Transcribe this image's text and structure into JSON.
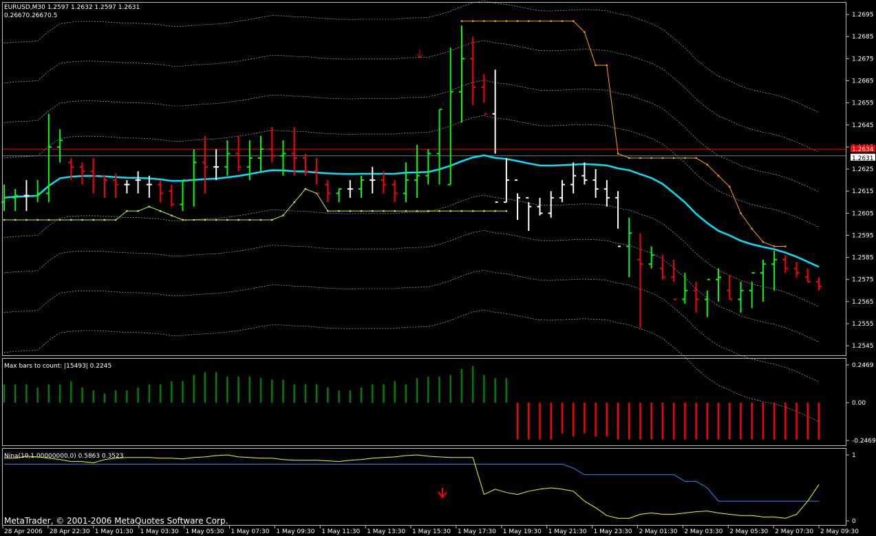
{
  "main_panel": {
    "symbol_line": "EURUSD,M30  1.2597 1.2632 1.2597 1.2631",
    "sub_line": "0.26670.26670.5",
    "price_ticks": [
      "1.2695",
      "1.2685",
      "1.2675",
      "1.2665",
      "1.2655",
      "1.2645",
      "1.2635",
      "1.2625",
      "1.2615",
      "1.2605",
      "1.2595",
      "1.2585",
      "1.2575",
      "1.2565",
      "1.2555",
      "1.2545"
    ],
    "red_line_label": "1.2634",
    "current_price_label": "1.2631",
    "red_line_value": 1.2634,
    "current_price": 1.2631
  },
  "osc_panel": {
    "title": "Max bars to count: |15493|  0.2245",
    "ticks": [
      "0.2469",
      "0.00",
      "-0.2469"
    ]
  },
  "nina_panel": {
    "title": "Nina(10,1.00000000,0) 0.5863 0.3523",
    "ticks": [
      "1",
      "0"
    ]
  },
  "copyright": "MetaTrader, © 2001-2006 MetaQuotes Software Corp.",
  "time_labels": [
    "28 Apr 2006",
    "28 Apr 22:30",
    "1 May 01:30",
    "1 May 03:30",
    "1 May 05:30",
    "1 May 07:30",
    "1 May 09:30",
    "1 May 11:30",
    "1 May 13:30",
    "1 May 15:30",
    "1 May 17:30",
    "1 May 19:30",
    "1 May 21:30",
    "1 May 23:30",
    "2 May 01:30",
    "2 May 03:30",
    "2 May 05:30",
    "2 May 07:30",
    "2 May 09:30"
  ],
  "colors": {
    "bull": "#00ff00",
    "bear": "#ff0000",
    "neutral": "#ffffff",
    "ma": "#00e5ff",
    "trail_up": "#adff2f",
    "trail_down": "#ffa500",
    "envelope": "#ffffff",
    "osc_pos": "#008000",
    "osc_neg": "#ff0000",
    "nina_fast": "#ffff00",
    "nina_slow": "#1e90ff",
    "grid": "#c0c0c0",
    "red_line": "#ff0000",
    "price_line": "#708090"
  },
  "chart_data": [
    {
      "type": "ohlc",
      "title": "EURUSD,M30  1.2597 1.2632 1.2597 1.2631",
      "ylim": [
        1.2541,
        1.27
      ],
      "x": [
        0,
        1,
        2,
        3,
        4,
        5,
        6,
        7,
        8,
        9,
        10,
        11,
        12,
        13,
        14,
        15,
        16,
        17,
        18,
        19,
        20,
        21,
        22,
        23,
        24,
        25,
        26,
        27,
        28,
        29,
        30,
        31,
        32,
        33,
        34,
        35,
        36,
        37,
        38,
        39,
        40,
        41,
        42,
        43,
        44,
        45,
        46,
        47,
        48,
        49,
        50,
        51,
        52,
        53,
        54,
        55,
        56,
        57,
        58,
        59,
        60,
        61,
        62,
        63,
        64,
        65,
        66,
        67,
        68,
        69,
        70,
        71,
        72,
        73
      ],
      "open": [
        1.261,
        1.2612,
        1.2613,
        1.2613,
        1.2614,
        1.2635,
        1.2628,
        1.2626,
        1.2624,
        1.2622,
        1.262,
        1.2618,
        1.262,
        1.2618,
        1.2618,
        1.2615,
        1.2609,
        1.262,
        1.2628,
        1.2626,
        1.2626,
        1.2632,
        1.2626,
        1.263,
        1.2634,
        1.2631,
        1.2632,
        1.263,
        1.2624,
        1.2618,
        1.2614,
        1.2616,
        1.2616,
        1.262,
        1.262,
        1.2618,
        1.2614,
        1.262,
        1.2622,
        1.2632,
        1.2618,
        1.266,
        1.2675,
        1.2662,
        1.265,
        1.261,
        1.262,
        1.2612,
        1.2608,
        1.2605,
        1.2612,
        1.2618,
        1.2622,
        1.262,
        1.2616,
        1.2612,
        1.259,
        1.2584,
        1.2582,
        1.258,
        1.2576,
        1.2566,
        1.257,
        1.2566,
        1.2575,
        1.257,
        1.2566,
        1.257,
        1.2578,
        1.2582,
        1.2584,
        1.258,
        1.2576,
        1.2574
      ],
      "high": [
        1.2618,
        1.2616,
        1.262,
        1.262,
        1.265,
        1.2643,
        1.263,
        1.2628,
        1.263,
        1.2622,
        1.2623,
        1.262,
        1.2624,
        1.2622,
        1.262,
        1.2618,
        1.262,
        1.2634,
        1.264,
        1.2634,
        1.2638,
        1.264,
        1.2638,
        1.264,
        1.2644,
        1.2638,
        1.2644,
        1.2632,
        1.263,
        1.262,
        1.2616,
        1.262,
        1.2622,
        1.2626,
        1.2624,
        1.262,
        1.2628,
        1.2636,
        1.2634,
        1.2652,
        1.268,
        1.269,
        1.2685,
        1.2668,
        1.267,
        1.263,
        1.2614,
        1.261,
        1.2612,
        1.2615,
        1.262,
        1.2628,
        1.2628,
        1.2625,
        1.262,
        1.2615,
        1.2603,
        1.2596,
        1.259,
        1.2586,
        1.2584,
        1.2578,
        1.2574,
        1.257,
        1.258,
        1.2577,
        1.2574,
        1.2574,
        1.2584,
        1.2588,
        1.2586,
        1.2583,
        1.258,
        1.2576
      ],
      "low": [
        1.2606,
        1.2606,
        1.2606,
        1.261,
        1.261,
        1.2628,
        1.262,
        1.2618,
        1.2614,
        1.2612,
        1.2612,
        1.2614,
        1.2614,
        1.2612,
        1.261,
        1.2608,
        1.2606,
        1.2608,
        1.2614,
        1.262,
        1.2622,
        1.2624,
        1.262,
        1.2624,
        1.2628,
        1.2622,
        1.2622,
        1.2622,
        1.2618,
        1.261,
        1.261,
        1.2612,
        1.2612,
        1.2614,
        1.2614,
        1.261,
        1.261,
        1.2612,
        1.2618,
        1.2618,
        1.2618,
        1.2646,
        1.2654,
        1.2655,
        1.2632,
        1.261,
        1.2602,
        1.2597,
        1.2604,
        1.2603,
        1.261,
        1.2614,
        1.2618,
        1.2612,
        1.2608,
        1.2598,
        1.2576,
        1.2553,
        1.258,
        1.2575,
        1.2574,
        1.2564,
        1.256,
        1.2558,
        1.2565,
        1.2566,
        1.256,
        1.2562,
        1.2565,
        1.257,
        1.2578,
        1.2576,
        1.2574,
        1.257
      ],
      "close": [
        1.2612,
        1.2613,
        1.2613,
        1.2614,
        1.2635,
        1.2638,
        1.2626,
        1.2624,
        1.2622,
        1.262,
        1.2618,
        1.2618,
        1.262,
        1.2618,
        1.2614,
        1.2609,
        1.262,
        1.2628,
        1.2626,
        1.2626,
        1.2632,
        1.2626,
        1.263,
        1.2634,
        1.2631,
        1.2632,
        1.263,
        1.2624,
        1.2614,
        1.2614,
        1.2616,
        1.2616,
        1.262,
        1.262,
        1.2618,
        1.2614,
        1.262,
        1.2622,
        1.2632,
        1.2652,
        1.266,
        1.2675,
        1.2662,
        1.265,
        1.261,
        1.262,
        1.2612,
        1.2608,
        1.2605,
        1.2612,
        1.2618,
        1.2622,
        1.262,
        1.2616,
        1.2612,
        1.259,
        1.2596,
        1.2582,
        1.2586,
        1.2576,
        1.2566,
        1.257,
        1.2566,
        1.2575,
        1.2576,
        1.2566,
        1.257,
        1.2578,
        1.2582,
        1.2584,
        1.258,
        1.2578,
        1.2574,
        1.2572
      ]
    },
    {
      "type": "bar",
      "title": "Max bars to count: |15493|  0.2245",
      "ylim": [
        -0.2469,
        0.2469
      ],
      "values": [
        0.12,
        0.12,
        0.12,
        0.1,
        0.12,
        0.12,
        0.14,
        0.1,
        0.08,
        0.06,
        0.08,
        0.08,
        0.1,
        0.12,
        0.12,
        0.14,
        0.14,
        0.18,
        0.2,
        0.2,
        0.17,
        0.17,
        0.17,
        0.16,
        0.15,
        0.15,
        0.12,
        0.12,
        0.12,
        0.1,
        0.08,
        0.08,
        0.1,
        0.12,
        0.12,
        0.14,
        0.12,
        0.16,
        0.17,
        0.17,
        0.18,
        0.22,
        0.24,
        0.18,
        0.16,
        0.16,
        -0.24,
        -0.24,
        -0.24,
        -0.24,
        -0.2,
        -0.22,
        -0.2,
        -0.22,
        -0.22,
        -0.24,
        -0.24,
        -0.24,
        -0.24,
        -0.24,
        -0.24,
        -0.24,
        -0.24,
        -0.24,
        -0.24,
        -0.24,
        -0.24,
        -0.24,
        -0.24,
        -0.24,
        -0.24,
        -0.24,
        -0.24,
        -0.24
      ]
    },
    {
      "type": "line",
      "title": "Nina(10,1.00000000,0) 0.5863 0.3523",
      "ylim": [
        0,
        1
      ],
      "series": [
        {
          "values": [
            0.86,
            0.86,
            0.86,
            0.86,
            0.86,
            0.86,
            0.86,
            0.86,
            0.86,
            0.86,
            0.86,
            0.86,
            0.86,
            0.86,
            0.86,
            0.86,
            0.86,
            0.86,
            0.86,
            0.86,
            0.86,
            0.86,
            0.86,
            0.86,
            0.86,
            0.86,
            0.86,
            0.86,
            0.86,
            0.86,
            0.86,
            0.86,
            0.86,
            0.86,
            0.86,
            0.86,
            0.86,
            0.86,
            0.86,
            0.86,
            0.86,
            0.86,
            0.86,
            0.86,
            0.86,
            0.86,
            0.86,
            0.86,
            0.86,
            0.86,
            0.86,
            0.8,
            0.7,
            0.7,
            0.7,
            0.7,
            0.7,
            0.7,
            0.7,
            0.7,
            0.7,
            0.6,
            0.6,
            0.5,
            0.3,
            0.3,
            0.3,
            0.3,
            0.3,
            0.3,
            0.3,
            0.3,
            0.3,
            0.3
          ]
        },
        {
          "values": [
            0.95,
            0.95,
            0.98,
            0.97,
            0.95,
            0.93,
            0.9,
            0.9,
            0.88,
            0.93,
            0.95,
            0.96,
            0.96,
            0.96,
            0.95,
            0.95,
            0.94,
            0.96,
            0.97,
            0.99,
            1.0,
            0.97,
            0.96,
            0.95,
            0.95,
            0.93,
            0.92,
            0.92,
            0.92,
            0.91,
            0.9,
            0.92,
            0.93,
            0.95,
            0.96,
            0.97,
            0.99,
            1.0,
            0.98,
            0.97,
            0.96,
            0.96,
            0.96,
            0.4,
            0.48,
            0.43,
            0.4,
            0.45,
            0.48,
            0.5,
            0.48,
            0.45,
            0.3,
            0.2,
            0.08,
            0.04,
            0.04,
            0.1,
            0.12,
            0.1,
            0.1,
            0.12,
            0.14,
            0.15,
            0.12,
            0.1,
            0.08,
            0.08,
            0.06,
            0.06,
            0.04,
            0.1,
            0.3,
            0.55
          ]
        }
      ]
    }
  ]
}
